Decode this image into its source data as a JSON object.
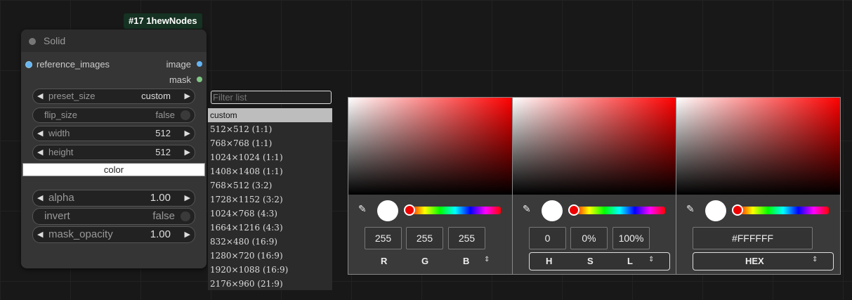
{
  "badge": "#17 1hewNodes",
  "node": {
    "title": "Solid",
    "input": "reference_images",
    "outputs": [
      "image",
      "mask"
    ],
    "widgets": {
      "preset_size": {
        "label": "preset_size",
        "value": "custom"
      },
      "flip_size": {
        "label": "flip_size",
        "value": "false"
      },
      "width": {
        "label": "width",
        "value": "512"
      },
      "height": {
        "label": "height",
        "value": "512"
      },
      "color": {
        "label": "color"
      },
      "alpha": {
        "label": "alpha",
        "value": "1.00"
      },
      "invert": {
        "label": "invert",
        "value": "false"
      },
      "mask_opacity": {
        "label": "mask_opacity",
        "value": "1.00"
      }
    }
  },
  "dropdown": {
    "placeholder": "Filter list",
    "items": [
      "custom",
      "512×512 (1:1)",
      "768×768 (1:1)",
      "1024×1024 (1:1)",
      "1408×1408 (1:1)",
      "768×512 (3:2)",
      "1728×1152 (3:2)",
      "1024×768 (4:3)",
      "1664×1216 (4:3)",
      "832×480 (16:9)",
      "1280×720 (16:9)",
      "1920×1088 (16:9)",
      "2176×960 (21:9)"
    ]
  },
  "picker": {
    "rgb": {
      "values": [
        "255",
        "255",
        "255"
      ],
      "labels": [
        "R",
        "G",
        "B"
      ]
    },
    "hsl": {
      "values": [
        "0",
        "0%",
        "100%"
      ],
      "labels": [
        "H",
        "S",
        "L"
      ]
    },
    "hex": {
      "value": "#FFFFFF",
      "label": "HEX"
    }
  },
  "colors": {
    "selected": "#FFFFFF",
    "hue": "#FF0000"
  }
}
